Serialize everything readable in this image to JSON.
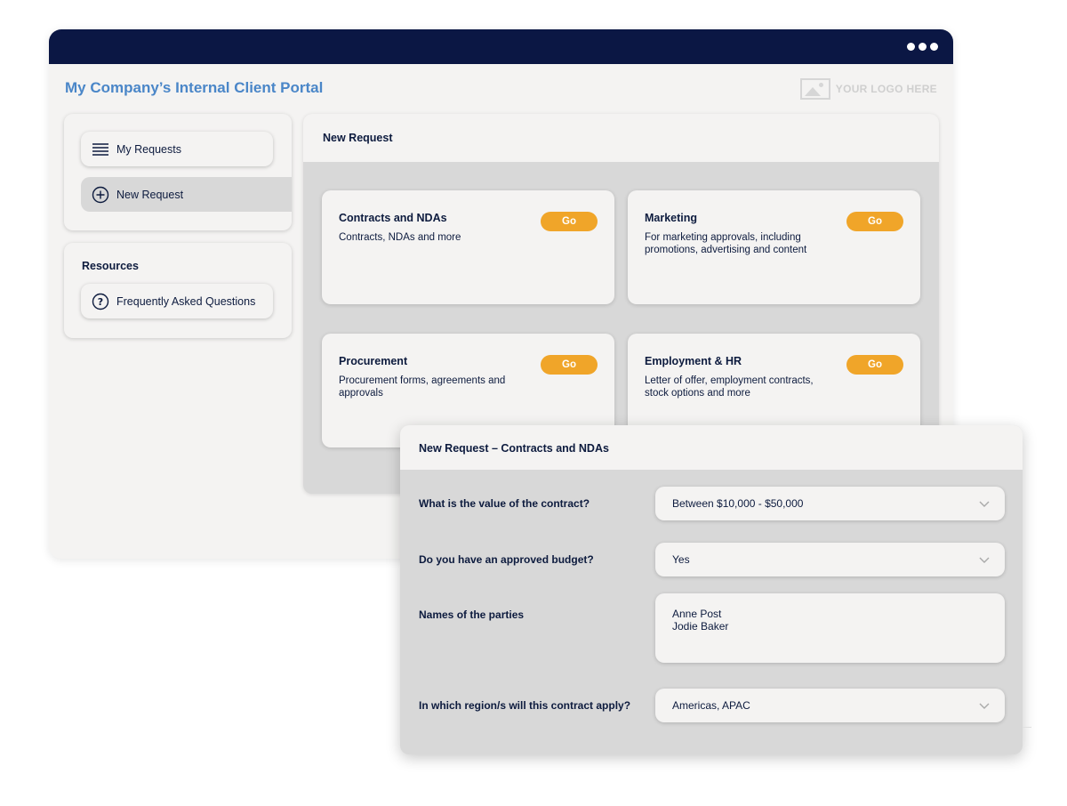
{
  "portal": {
    "title": "My Company’s Internal Client Portal",
    "logo_text": "YOUR LOGO HERE"
  },
  "sidebar": {
    "items": [
      {
        "label": "My Requests",
        "icon": "list-icon"
      },
      {
        "label": "New Request",
        "icon": "plus-circle-icon",
        "active": true
      }
    ],
    "resources": {
      "heading": "Resources",
      "items": [
        {
          "label": "Frequently Asked Questions",
          "icon": "question-circle-icon"
        }
      ]
    }
  },
  "main": {
    "title": "New Request",
    "cards": [
      {
        "title": "Contracts and NDAs",
        "description": "Contracts, NDAs and more",
        "button": "Go"
      },
      {
        "title": "Marketing",
        "description": "For marketing approvals, including promotions, advertising and content",
        "button": "Go"
      },
      {
        "title": "Procurement",
        "description": "Procurement forms, agreements and approvals",
        "button": "Go"
      },
      {
        "title": "Employment & HR",
        "description": "Letter of offer, employment contracts, stock options and more",
        "button": "Go"
      }
    ]
  },
  "modal": {
    "title": "New Request – Contracts and NDAs",
    "fields": [
      {
        "label": "What is the value of the contract?",
        "value": "Between $10,000 - $50,000",
        "type": "select"
      },
      {
        "label": "Do you have an approved budget?",
        "value": "Yes",
        "type": "select"
      },
      {
        "label": "Names of the parties",
        "lines": [
          "Anne Post",
          "Jodie Baker"
        ],
        "type": "textarea"
      },
      {
        "label": "In which region/s will this contract apply?",
        "value": "Americas, APAC",
        "type": "select"
      }
    ]
  },
  "colors": {
    "titlebar": "#0b1744",
    "accent_title": "#4a86c8",
    "go_button": "#f0a529",
    "panel_bg": "#f4f3f2",
    "content_bg": "#d8d8d8",
    "text": "#0d1b3e"
  }
}
